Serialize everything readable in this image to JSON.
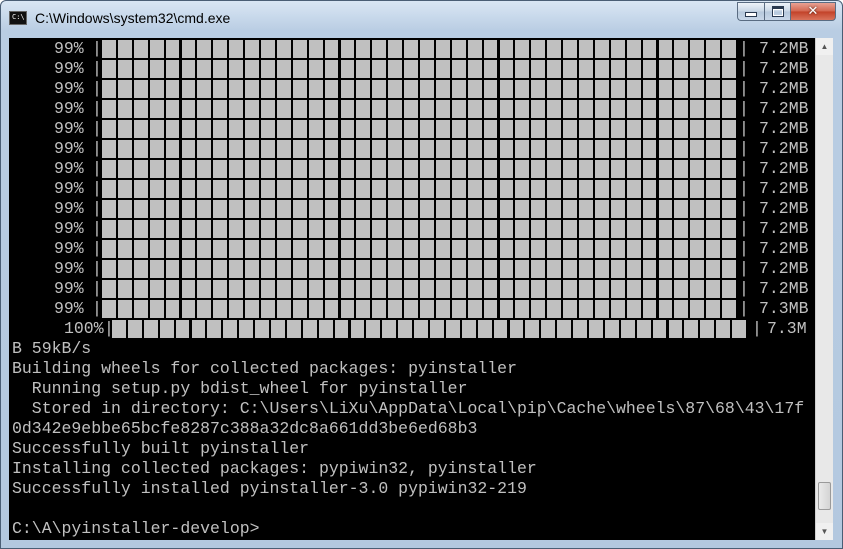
{
  "window": {
    "title": "C:\\Windows\\system32\\cmd.exe"
  },
  "progress_rows": [
    {
      "percent": "99%",
      "filled": 0.99,
      "size": "7.2MB"
    },
    {
      "percent": "99%",
      "filled": 0.99,
      "size": "7.2MB"
    },
    {
      "percent": "99%",
      "filled": 0.99,
      "size": "7.2MB"
    },
    {
      "percent": "99%",
      "filled": 0.99,
      "size": "7.2MB"
    },
    {
      "percent": "99%",
      "filled": 0.99,
      "size": "7.2MB"
    },
    {
      "percent": "99%",
      "filled": 0.99,
      "size": "7.2MB"
    },
    {
      "percent": "99%",
      "filled": 0.99,
      "size": "7.2MB"
    },
    {
      "percent": "99%",
      "filled": 0.99,
      "size": "7.2MB"
    },
    {
      "percent": "99%",
      "filled": 0.99,
      "size": "7.2MB"
    },
    {
      "percent": "99%",
      "filled": 0.99,
      "size": "7.2MB"
    },
    {
      "percent": "99%",
      "filled": 0.99,
      "size": "7.2MB"
    },
    {
      "percent": "99%",
      "filled": 0.99,
      "size": "7.2MB"
    },
    {
      "percent": "99%",
      "filled": 0.99,
      "size": "7.2MB"
    },
    {
      "percent": "99%",
      "filled": 0.99,
      "size": "7.3MB"
    }
  ],
  "final_row": {
    "percent": "100%",
    "filled": 1.0,
    "size": "7.3M"
  },
  "output_lines": [
    "B 59kB/s",
    "Building wheels for collected packages: pyinstaller",
    "  Running setup.py bdist_wheel for pyinstaller",
    "  Stored in directory: C:\\Users\\LiXu\\AppData\\Local\\pip\\Cache\\wheels\\87\\68\\43\\17f",
    "0d342e9ebbe65bcfe8287c388a32dc8a661dd3be6ed68b3",
    "Successfully built pyinstaller",
    "Installing collected packages: pypiwin32, pyinstaller",
    "Successfully installed pyinstaller-3.0 pypiwin32-219",
    ""
  ],
  "prompt": "C:\\A\\pyinstaller-develop>",
  "icons": {
    "app": "cmd-icon",
    "minimize": "minimize-icon",
    "maximize": "maximize-icon",
    "close": "close-icon"
  }
}
